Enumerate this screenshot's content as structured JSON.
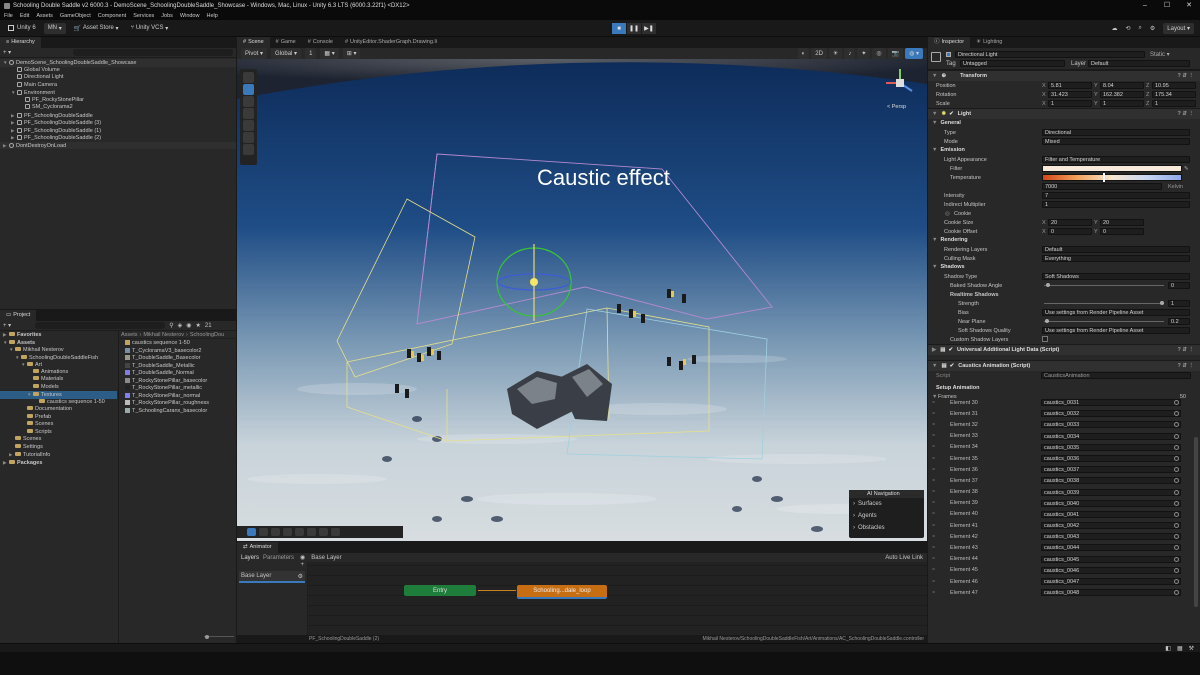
{
  "window": {
    "title": "Schooling Double Saddle v2 6000.3 - DemoScene_SchoolingDoubleSaddle_Showcase - Windows, Mac, Linux - Unity 6.3 LTS (6000.3.22f1) <DX12>",
    "min": "–",
    "max": "☐",
    "close": "✕"
  },
  "menu": [
    "File",
    "Edit",
    "Assets",
    "GameObject",
    "Component",
    "Services",
    "Jobs",
    "Window",
    "Help"
  ],
  "toolbar": {
    "unity": "Unity 6",
    "account": "MN",
    "asset_store": "Asset Store",
    "vcs": "Unity VCS",
    "layout": "Layout"
  },
  "hierarchy": {
    "tab": "Hierarchy",
    "rows": [
      {
        "label": "DemoScene_SchoolingDoubleSaddle_Showcase",
        "depth": 0,
        "arrow": "▼",
        "scene": true
      },
      {
        "label": "Global Volume",
        "depth": 1,
        "arrow": ""
      },
      {
        "label": "Directional Light",
        "depth": 1,
        "arrow": ""
      },
      {
        "label": "Main Camera",
        "depth": 1,
        "arrow": ""
      },
      {
        "label": "Environment",
        "depth": 1,
        "arrow": "▼"
      },
      {
        "label": "PF_RockyStonePillar",
        "depth": 2,
        "arrow": ""
      },
      {
        "label": "SM_Cyclorama2",
        "depth": 2,
        "arrow": ""
      },
      {
        "label": "PF_SchoolingDoubleSaddle",
        "depth": 1,
        "arrow": "▶"
      },
      {
        "label": "PF_SchoolingDoubleSaddle (3)",
        "depth": 1,
        "arrow": "▶"
      },
      {
        "label": "PF_SchoolingDoubleSaddle (1)",
        "depth": 1,
        "arrow": "▶"
      },
      {
        "label": "PF_SchoolingDoubleSaddle (2)",
        "depth": 1,
        "arrow": "▶"
      },
      {
        "label": "DontDestroyOnLoad",
        "depth": 0,
        "arrow": "▶",
        "scene": true
      }
    ]
  },
  "project": {
    "tab": "Project",
    "count": "21",
    "breadcrumb": [
      "Assets",
      "Mikhail Nesterov",
      "SchoolingDou"
    ],
    "tree": [
      {
        "label": "Favorites",
        "depth": 0,
        "arrow": "▶",
        "bold": true
      },
      {
        "label": "Assets",
        "depth": 0,
        "arrow": "▼",
        "bold": true
      },
      {
        "label": "Mikhail Nesterov",
        "depth": 1,
        "arrow": "▼"
      },
      {
        "label": "SchoolingDoubleSaddleFish",
        "depth": 2,
        "arrow": "▼"
      },
      {
        "label": "Art",
        "depth": 3,
        "arrow": "▼"
      },
      {
        "label": "Animations",
        "depth": 4,
        "arrow": ""
      },
      {
        "label": "Materials",
        "depth": 4,
        "arrow": ""
      },
      {
        "label": "Models",
        "depth": 4,
        "arrow": ""
      },
      {
        "label": "Textures",
        "depth": 4,
        "arrow": "▼"
      },
      {
        "label": "caustics sequence 1-50",
        "depth": 5,
        "arrow": ""
      },
      {
        "label": "Documentation",
        "depth": 3,
        "arrow": ""
      },
      {
        "label": "Prefab",
        "depth": 3,
        "arrow": ""
      },
      {
        "label": "Scenes",
        "depth": 3,
        "arrow": ""
      },
      {
        "label": "Scripts",
        "depth": 3,
        "arrow": ""
      },
      {
        "label": "Scenes",
        "depth": 1,
        "arrow": ""
      },
      {
        "label": "Settings",
        "depth": 1,
        "arrow": ""
      },
      {
        "label": "TutorialInfo",
        "depth": 1,
        "arrow": "▶"
      },
      {
        "label": "Packages",
        "depth": 0,
        "arrow": "▶",
        "bold": true
      }
    ],
    "files": [
      {
        "label": "caustics sequence 1-50",
        "color": "#c0a460"
      },
      {
        "label": "T_CycloramaV3_basecolor2",
        "color": "#7a8fa6"
      },
      {
        "label": "T_DoubleSaddle_Basecolor",
        "color": "#9a9a8a"
      },
      {
        "label": "T_DoubleSaddle_Metallic",
        "color": "#444"
      },
      {
        "label": "T_DoubleSaddle_Normal",
        "color": "#7f7fe0"
      },
      {
        "label": "T_RockyStonePillar_basecolor",
        "color": "#8a8a8a"
      },
      {
        "label": "T_RockyStonePillar_metallic",
        "color": "#222"
      },
      {
        "label": "T_RockyStonePillar_normal",
        "color": "#8080f0"
      },
      {
        "label": "T_RockyStonePillar_roughness",
        "color": "#bbb"
      },
      {
        "label": "T_SchoolingCaranx_basecolor",
        "color": "#9aa"
      }
    ]
  },
  "scene": {
    "tabs": [
      "Scene",
      "Game",
      "Console",
      "UnityEditor.ShaderGraph.Drawing.Ii"
    ],
    "pivot": "Pivot",
    "global": "Global",
    "grid": "1",
    "persp": "< Persp",
    "caption": "Caustic effect",
    "ai_nav": {
      "title": "AI Navigation",
      "items": [
        "Surfaces",
        "Agents",
        "Obstacles"
      ]
    }
  },
  "animator": {
    "tab": "Animator",
    "tabs": [
      "Layers",
      "Parameters"
    ],
    "base_layer_crumb": "Base Layer",
    "auto_live": "Auto Live Link",
    "layer": "Base Layer",
    "entry": "Entry",
    "state": "Schooling...dale_loop",
    "footer_left": "PF_SchoolingDoubleSaddle (2)",
    "footer_right": "Mikhail Nesterov/SchoolingDoubleSaddleFish/Art/Animations/AC_SchoolingDoubleSaddle.controller"
  },
  "inspector": {
    "tabs": [
      "Inspector",
      "Lighting"
    ],
    "object": "Directional Light",
    "static": "Static",
    "tag_label": "Tag",
    "tag": "Untagged",
    "layer_label": "Layer",
    "layer": "Default",
    "transform": {
      "title": "Transform",
      "position": {
        "label": "Position",
        "x": "5.81",
        "y": "8.04",
        "z": "10.95"
      },
      "rotation": {
        "label": "Rotation",
        "x": "31.423",
        "y": "162.382",
        "z": "175.34"
      },
      "scale": {
        "label": "Scale",
        "x": "1",
        "y": "1",
        "z": "1"
      }
    },
    "light": {
      "title": "Light",
      "general": "General",
      "type_label": "Type",
      "type": "Directional",
      "mode_label": "Mode",
      "mode": "Mixed",
      "emission": "Emission",
      "appearance_label": "Light Appearance",
      "appearance": "Filter and Temperature",
      "filter_label": "Filter",
      "temperature_label": "Temperature",
      "temperature": "7000",
      "kelvin": "Kelvin",
      "intensity_label": "Intensity",
      "intensity": "7",
      "indirect_label": "Indirect Multiplier",
      "indirect": "1",
      "cookie_label": "Cookie",
      "cookie_size_label": "Cookie Size",
      "cookie_size_x": "20",
      "cookie_size_y": "20",
      "cookie_offset_label": "Cookie Offset",
      "cookie_offset_x": "0",
      "cookie_offset_y": "0",
      "rendering": "Rendering",
      "rlayers_label": "Rendering Layers",
      "rlayers": "Default",
      "culling_label": "Culling Mask",
      "culling": "Everything",
      "shadows": "Shadows",
      "shadow_type_label": "Shadow Type",
      "shadow_type": "Soft Shadows",
      "baked_angle_label": "Baked Shadow Angle",
      "baked_angle": "0",
      "realtime": "Realtime Shadows",
      "strength_label": "Strength",
      "strength": "1",
      "bias_label": "Bias",
      "bias": "Use settings from Render Pipeline Asset",
      "near_label": "Near Plane",
      "near": "0.2",
      "quality_label": "Soft Shadows Quality",
      "quality": "Use settings from Render Pipeline Asset",
      "custom_label": "Custom Shadow Layers"
    },
    "urp_light": "Universal Additional Light Data (Script)",
    "caustics": {
      "title": "Caustics Animation (Script)",
      "script_label": "Script",
      "script": "CausticsAnimation",
      "setup": "Setup Animation",
      "frames_label": "Frames",
      "frames": "50",
      "elements": [
        {
          "label": "Element 30",
          "value": "caustics_0031"
        },
        {
          "label": "Element 31",
          "value": "caustics_0032"
        },
        {
          "label": "Element 32",
          "value": "caustics_0033"
        },
        {
          "label": "Element 33",
          "value": "caustics_0034"
        },
        {
          "label": "Element 34",
          "value": "caustics_0035"
        },
        {
          "label": "Element 35",
          "value": "caustics_0036"
        },
        {
          "label": "Element 36",
          "value": "caustics_0037"
        },
        {
          "label": "Element 37",
          "value": "caustics_0038"
        },
        {
          "label": "Element 38",
          "value": "caustics_0039"
        },
        {
          "label": "Element 39",
          "value": "caustics_0040"
        },
        {
          "label": "Element 40",
          "value": "caustics_0041"
        },
        {
          "label": "Element 41",
          "value": "caustics_0042"
        },
        {
          "label": "Element 42",
          "value": "caustics_0043"
        },
        {
          "label": "Element 43",
          "value": "caustics_0044"
        },
        {
          "label": "Element 44",
          "value": "caustics_0045"
        },
        {
          "label": "Element 45",
          "value": "caustics_0046"
        },
        {
          "label": "Element 46",
          "value": "caustics_0047"
        },
        {
          "label": "Element 47",
          "value": "caustics_0048"
        }
      ]
    }
  },
  "colors": {
    "accent": "#3a79bb",
    "entry": "#1e7d3a",
    "state": "#c76d12",
    "water": "#1f4d86"
  }
}
